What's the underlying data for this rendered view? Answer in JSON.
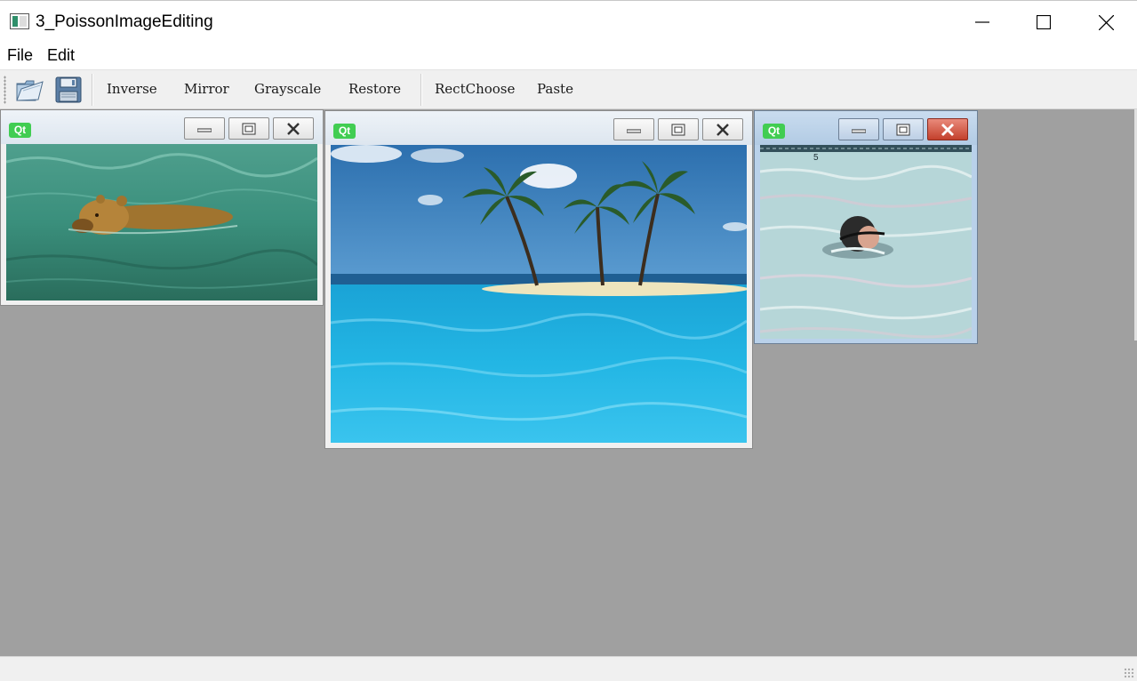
{
  "window": {
    "title": "3_PoissonImageEditing",
    "controls": [
      "minimize",
      "maximize",
      "close"
    ]
  },
  "menu": {
    "file": "File",
    "edit": "Edit"
  },
  "toolbar": {
    "open_icon": "folder-open-icon",
    "save_icon": "floppy-save-icon",
    "inverse": "Inverse",
    "mirror": "Mirror",
    "grayscale": "Grayscale",
    "restore": "Restore",
    "rectchoose": "RectChoose",
    "paste": "Paste"
  },
  "subwindows": [
    {
      "badge": "Qt",
      "image": "bear swimming in green water",
      "active": false
    },
    {
      "badge": "Qt",
      "image": "tropical island with three palm trees over turquoise sea",
      "active": false
    },
    {
      "badge": "Qt",
      "image": "person swimming in pool with lane marker 5",
      "active": true,
      "pool_marker": "5"
    }
  ],
  "colors": {
    "mdi_background": "#a0a0a0",
    "qt_badge": "#41cd52",
    "active_close": "#c3402c",
    "active_frame": "#b9d1ea"
  }
}
